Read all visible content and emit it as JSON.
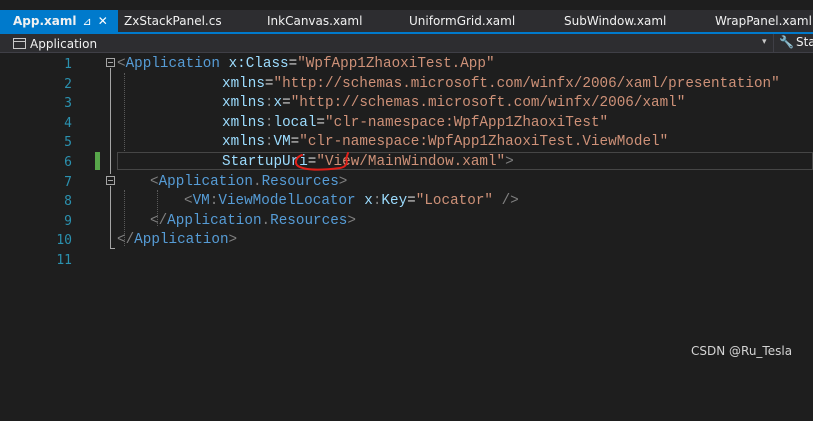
{
  "tabs": [
    {
      "label": "App.xaml",
      "active": true,
      "pin": "⊿",
      "close": "✕"
    },
    {
      "label": "ZxStackPanel.cs",
      "active": false
    },
    {
      "label": "InkCanvas.xaml",
      "active": false
    },
    {
      "label": "UniformGrid.xaml",
      "active": false
    },
    {
      "label": "SubWindow.xaml",
      "active": false
    },
    {
      "label": "WrapPanel.xaml",
      "active": false
    }
  ],
  "navbar": {
    "left_label": "Application",
    "right_label": "Sta",
    "dropdown_glyph": "▾",
    "wrench_glyph": "🔧"
  },
  "editor": {
    "line_numbers": [
      "1",
      "2",
      "3",
      "4",
      "5",
      "6",
      "7",
      "8",
      "9",
      "10",
      "11"
    ],
    "lines": [
      [
        [
          "delim",
          "<"
        ],
        [
          "elem",
          "Application"
        ],
        [
          "eq",
          " "
        ],
        [
          "attr",
          "x:Class"
        ],
        [
          "eq",
          "="
        ],
        [
          "val",
          "\"WpfApp1ZhaoxiTest.App\""
        ]
      ],
      [
        [
          "attr",
          "xmlns"
        ],
        [
          "eq",
          "="
        ],
        [
          "val",
          "\"http://schemas.microsoft.com/winfx/2006/xaml/presentation\""
        ]
      ],
      [
        [
          "attr",
          "xmlns"
        ],
        [
          "delim",
          ":"
        ],
        [
          "attr",
          "x"
        ],
        [
          "eq",
          "="
        ],
        [
          "val",
          "\"http://schemas.microsoft.com/winfx/2006/xaml\""
        ]
      ],
      [
        [
          "attr",
          "xmlns"
        ],
        [
          "delim",
          ":"
        ],
        [
          "attr",
          "local"
        ],
        [
          "eq",
          "="
        ],
        [
          "val",
          "\"clr-namespace:WpfApp1ZhaoxiTest\""
        ]
      ],
      [
        [
          "attr",
          "xmlns"
        ],
        [
          "delim",
          ":"
        ],
        [
          "attr",
          "VM"
        ],
        [
          "eq",
          "="
        ],
        [
          "val",
          "\"clr-namespace:WpfApp1ZhaoxiTest.ViewModel\""
        ]
      ],
      [
        [
          "attr",
          "StartupUri"
        ],
        [
          "eq",
          "="
        ],
        [
          "val",
          "\"View/MainWindow.xaml\""
        ],
        [
          "delim",
          ">"
        ]
      ],
      [
        [
          "delim",
          "<"
        ],
        [
          "elem",
          "Application"
        ],
        [
          "delim",
          "."
        ],
        [
          "elem",
          "Resources"
        ],
        [
          "delim",
          ">"
        ]
      ],
      [
        [
          "delim",
          "<"
        ],
        [
          "elem",
          "VM"
        ],
        [
          "delim",
          ":"
        ],
        [
          "elem",
          "ViewModelLocator"
        ],
        [
          "eq",
          " "
        ],
        [
          "attr",
          "x"
        ],
        [
          "delim",
          ":"
        ],
        [
          "attr",
          "Key"
        ],
        [
          "eq",
          "="
        ],
        [
          "val",
          "\"Locator\""
        ],
        [
          "eq",
          " "
        ],
        [
          "delim",
          "/>"
        ]
      ],
      [
        [
          "delim",
          "</"
        ],
        [
          "elem",
          "Application"
        ],
        [
          "delim",
          "."
        ],
        [
          "elem",
          "Resources"
        ],
        [
          "delim",
          ">"
        ]
      ],
      [
        [
          "delim",
          "</"
        ],
        [
          "elem",
          "Application"
        ],
        [
          "delim",
          ">"
        ]
      ],
      []
    ]
  },
  "watermark": "CSDN @Ru_Tesla",
  "colors": {
    "accent": "#007acc",
    "editor_bg": "#1e1e1e",
    "line_number": "#2b91af",
    "element": "#569cd6",
    "attribute": "#9cdcfe",
    "value": "#ce9178",
    "delimiter": "#808080",
    "annotation": "#e0201a",
    "change_bar": "#57a64a"
  }
}
